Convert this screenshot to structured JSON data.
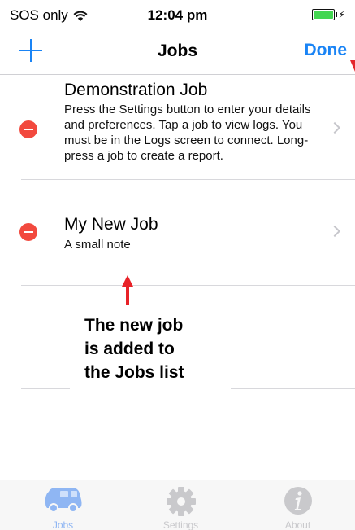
{
  "status_bar": {
    "carrier": "SOS only",
    "time": "12:04 pm",
    "battery_level": 1.0,
    "battery_color": "#43d651"
  },
  "nav": {
    "title": "Jobs",
    "add_icon": "plus-icon",
    "done_label": "Done",
    "accent_color": "#1a84f5"
  },
  "jobs": [
    {
      "title": "Demonstration Job",
      "description": "Press the Settings button to enter your details and preferences. Tap a job to view logs. You must be in the Logs screen to connect. Long-press a job to create a report."
    },
    {
      "title": "My New Job",
      "description": "A small note"
    }
  ],
  "annotation": {
    "text_lines": [
      "The new job",
      "is added to",
      "the Jobs list"
    ],
    "arrow_color": "#e82228"
  },
  "tabs": [
    {
      "label": "Jobs",
      "icon": "van-icon",
      "selected": true
    },
    {
      "label": "Settings",
      "icon": "gear-icon",
      "selected": false
    },
    {
      "label": "About",
      "icon": "info-icon",
      "selected": false
    }
  ]
}
